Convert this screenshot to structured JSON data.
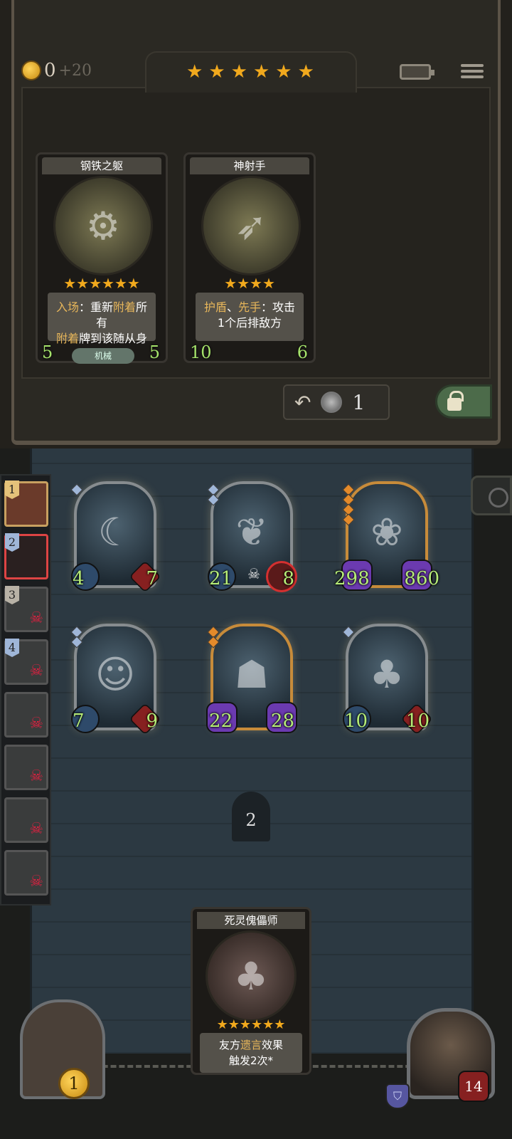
{
  "header": {
    "gold": "0",
    "gold_income": "+20",
    "tavern_stars": 6
  },
  "shop": {
    "cards": [
      {
        "name": "钢铁之躯",
        "stars": 6,
        "desc_line1_kw": "入场",
        "desc_line1_rest": "：重新",
        "desc_line1_kw2": "附着",
        "desc_line1_end": "所有",
        "desc_line2_kw": "附着",
        "desc_line2_rest": "牌到该随从身上",
        "attack": "5",
        "health": "5",
        "tag": "机械"
      },
      {
        "name": "神射手",
        "stars": 4,
        "desc_line1_kw": "护盾",
        "desc_line1_sep": "、",
        "desc_line1_kw2": "先手",
        "desc_line1_rest": "：攻击",
        "desc_line2": "1个后排敌方",
        "attack": "10",
        "health": "6"
      }
    ],
    "refresh_cost": "1"
  },
  "players": [
    {
      "rank": "1",
      "status": "first"
    },
    {
      "rank": "2",
      "status": "active"
    },
    {
      "rank": "3",
      "status": "dead"
    },
    {
      "rank": "4",
      "status": "dead"
    },
    {
      "rank": "",
      "status": "dead"
    },
    {
      "rank": "",
      "status": "dead"
    },
    {
      "rank": "",
      "status": "dead"
    },
    {
      "rank": "",
      "status": "dead"
    }
  ],
  "board": {
    "row1": [
      {
        "attack": "4",
        "health": "7"
      },
      {
        "attack": "21",
        "health": "8"
      },
      {
        "attack": "298",
        "health": "860"
      }
    ],
    "row2": [
      {
        "attack": "7",
        "health": "9"
      },
      {
        "attack": "22",
        "health": "28"
      },
      {
        "attack": "10",
        "health": "10"
      }
    ],
    "turn": "2"
  },
  "hand": {
    "name": "死灵傀儡师",
    "stars": 6,
    "desc_pre": "友方",
    "desc_kw": "遗言",
    "desc_post": "效果",
    "desc_line2": "触发2次*"
  },
  "hero": {
    "health": "14",
    "tavern_tier": "1"
  }
}
